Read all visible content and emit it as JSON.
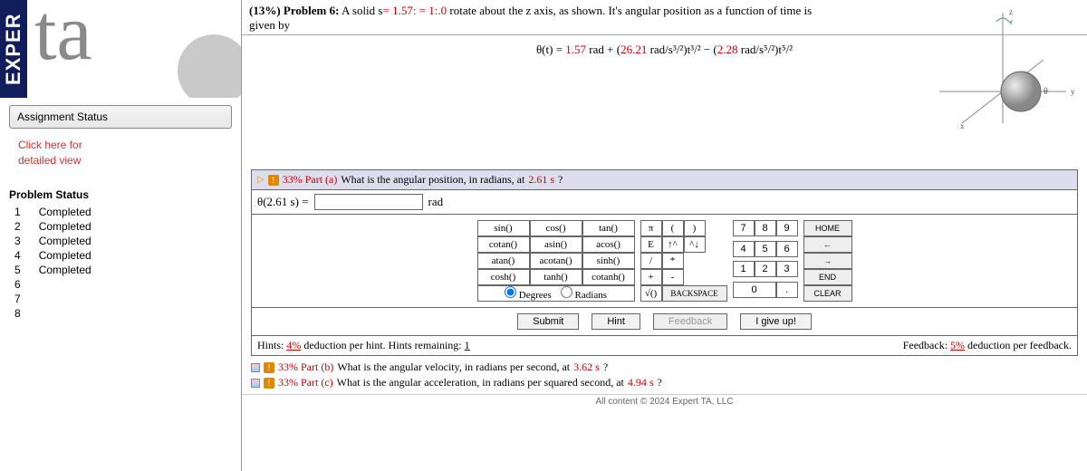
{
  "logo": {
    "exp": "EXPER",
    "ta": "ta"
  },
  "sidebar": {
    "assignment_status": "Assignment Status",
    "detail_link": "Click here for\ndetailed view",
    "problem_status_header": "Problem  Status",
    "problems": [
      {
        "n": "1",
        "status": "Completed"
      },
      {
        "n": "2",
        "status": "Completed"
      },
      {
        "n": "3",
        "status": "Completed"
      },
      {
        "n": "4",
        "status": "Completed"
      },
      {
        "n": "5",
        "status": "Completed"
      },
      {
        "n": "6",
        "status": ""
      },
      {
        "n": "7",
        "status": ""
      },
      {
        "n": "8",
        "status": ""
      }
    ]
  },
  "problem": {
    "pct": "(13%)",
    "label": "Problem 6:",
    "text1": "A solid s",
    "eq_inline": "= 1.57: = 1:.0",
    "text2": " rotate about the z axis, as shown. It's angular position as a function of time is",
    "given": "given by",
    "eq": "θ(t) = 1.57 rad + (26.21 rad/s³/²)t³/² − (2.28 rad/s⁵/²)t⁵/²"
  },
  "partA": {
    "pct": "33% Part (a)",
    "q1": "What is the angular position, in radians, at ",
    "t": "2.61 s",
    "q2": "?",
    "lhs": "θ(2.61 s) = ",
    "unit": "rad"
  },
  "calc": {
    "funcs": [
      "sin()",
      "cos()",
      "tan()",
      "cotan()",
      "asin()",
      "acos()",
      "atan()",
      "acotan()",
      "sinh()",
      "cosh()",
      "tanh()",
      "cotanh()"
    ],
    "deg": "Degrees",
    "rad": "Radians",
    "syms": [
      "π",
      "(",
      ")",
      "",
      "E",
      "↑^",
      "^↓",
      "",
      "/",
      "*",
      "",
      "",
      "+",
      "-",
      "",
      "",
      "√()",
      "",
      "",
      ""
    ],
    "nums": [
      "7",
      "8",
      "9",
      "4",
      "5",
      "6",
      "1",
      "2",
      "3",
      "0",
      "."
    ],
    "cmds": [
      "HOME",
      "←",
      "→",
      "END",
      "CLEAR"
    ],
    "backspace": "BACKSPACE"
  },
  "buttons": {
    "submit": "Submit",
    "hint": "Hint",
    "feedback": "Feedback",
    "giveup": "I give up!"
  },
  "hints": {
    "left1": "Hints: ",
    "left_pct": "4%",
    "left2": " deduction per hint. Hints remaining: ",
    "left_n": "1",
    "right1": "Feedback: ",
    "right_pct": "5%",
    "right2": " deduction per feedback."
  },
  "partB": {
    "pct": "33% Part (b)",
    "q": "What is the angular velocity, in radians per second, at ",
    "t": "3.62 s",
    "q2": "?"
  },
  "partC": {
    "pct": "33% Part (c)",
    "q": "What is the angular acceleration, in radians per squared second, at ",
    "t": "4.94 s",
    "q2": "?"
  },
  "footer": "All content © 2024 Expert TA, LLC"
}
